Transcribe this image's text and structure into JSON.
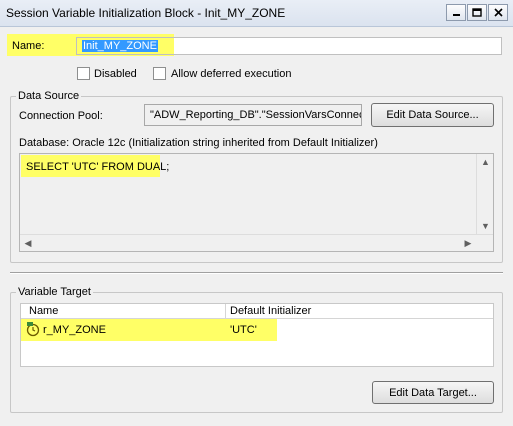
{
  "window": {
    "title": "Session Variable Initialization Block - Init_MY_ZONE"
  },
  "name": {
    "label": "Name:",
    "value": "Init_MY_ZONE"
  },
  "options": {
    "disabled_label": "Disabled",
    "deferred_label": "Allow deferred execution"
  },
  "data_source": {
    "group_label": "Data Source",
    "pool_label": "Connection Pool:",
    "pool_value": "\"ADW_Reporting_DB\".\"SessionVarsConnecti",
    "edit_button": "Edit Data Source...",
    "database_info": "Database: Oracle 12c (Initialization string inherited from Default Initializer)",
    "sql": "SELECT 'UTC' FROM DUAL;"
  },
  "variable_target": {
    "group_label": "Variable Target",
    "columns": [
      "Name",
      "Default Initializer"
    ],
    "rows": [
      {
        "name": "r_MY_ZONE",
        "initializer": "'UTC'"
      }
    ],
    "edit_button": "Edit Data Target..."
  },
  "colors": {
    "highlight": "#ffff66",
    "selection": "#3399ff"
  }
}
